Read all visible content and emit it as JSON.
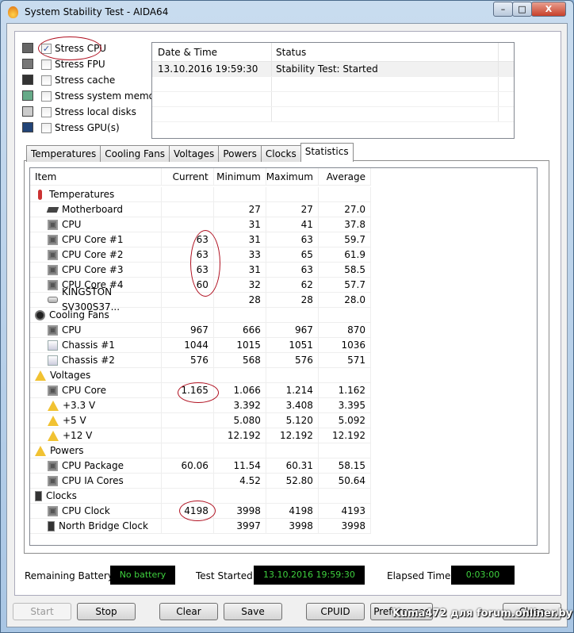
{
  "window": {
    "title": "System Stability Test - AIDA64",
    "min": "–",
    "max": "□",
    "close": "X"
  },
  "stress": [
    {
      "label": "Stress CPU",
      "checked": true,
      "icon": "cpu-icon"
    },
    {
      "label": "Stress FPU",
      "checked": false,
      "icon": "fpu-icon"
    },
    {
      "label": "Stress cache",
      "checked": false,
      "icon": "cache-icon"
    },
    {
      "label": "Stress system memory",
      "checked": false,
      "icon": "memory-icon"
    },
    {
      "label": "Stress local disks",
      "checked": false,
      "icon": "disk-icon"
    },
    {
      "label": "Stress GPU(s)",
      "checked": false,
      "icon": "gpu-icon"
    }
  ],
  "log": {
    "headers": [
      "Date & Time",
      "Status"
    ],
    "rows": [
      [
        "13.10.2016 19:59:30",
        "Stability Test: Started"
      ]
    ]
  },
  "tabs": [
    "Temperatures",
    "Cooling Fans",
    "Voltages",
    "Powers",
    "Clocks",
    "Statistics"
  ],
  "stats": {
    "headers": [
      "Item",
      "Current",
      "Minimum",
      "Maximum",
      "Average"
    ],
    "rows": [
      {
        "group": true,
        "icon": "thermo",
        "item": "Temperatures"
      },
      {
        "icon": "mb",
        "item": "Motherboard",
        "cur": "",
        "min": "27",
        "max": "27",
        "avg": "27.0"
      },
      {
        "icon": "chip",
        "item": "CPU",
        "cur": "",
        "min": "31",
        "max": "41",
        "avg": "37.8"
      },
      {
        "icon": "chip",
        "item": "CPU Core #1",
        "cur": "63",
        "min": "31",
        "max": "63",
        "avg": "59.7"
      },
      {
        "icon": "chip",
        "item": "CPU Core #2",
        "cur": "63",
        "min": "33",
        "max": "65",
        "avg": "61.9"
      },
      {
        "icon": "chip",
        "item": "CPU Core #3",
        "cur": "63",
        "min": "31",
        "max": "63",
        "avg": "58.5"
      },
      {
        "icon": "chip",
        "item": "CPU Core #4",
        "cur": "60",
        "min": "32",
        "max": "62",
        "avg": "57.7"
      },
      {
        "icon": "disk",
        "item": "KINGSTON SV300S37...",
        "cur": "",
        "min": "28",
        "max": "28",
        "avg": "28.0"
      },
      {
        "group": true,
        "icon": "fan",
        "item": "Cooling Fans"
      },
      {
        "icon": "chip",
        "item": "CPU",
        "cur": "967",
        "min": "666",
        "max": "967",
        "avg": "870"
      },
      {
        "icon": "chas",
        "item": "Chassis #1",
        "cur": "1044",
        "min": "1015",
        "max": "1051",
        "avg": "1036"
      },
      {
        "icon": "chas",
        "item": "Chassis #2",
        "cur": "576",
        "min": "568",
        "max": "576",
        "avg": "571"
      },
      {
        "group": true,
        "icon": "warn",
        "item": "Voltages"
      },
      {
        "icon": "chip",
        "item": "CPU Core",
        "cur": "1.165",
        "min": "1.066",
        "max": "1.214",
        "avg": "1.162"
      },
      {
        "icon": "warn",
        "item": "+3.3 V",
        "cur": "",
        "min": "3.392",
        "max": "3.408",
        "avg": "3.395"
      },
      {
        "icon": "warn",
        "item": "+5 V",
        "cur": "",
        "min": "5.080",
        "max": "5.120",
        "avg": "5.092"
      },
      {
        "icon": "warn",
        "item": "+12 V",
        "cur": "",
        "min": "12.192",
        "max": "12.192",
        "avg": "12.192"
      },
      {
        "group": true,
        "icon": "warn",
        "item": "Powers"
      },
      {
        "icon": "chip",
        "item": "CPU Package",
        "cur": "60.06",
        "min": "11.54",
        "max": "60.31",
        "avg": "58.15"
      },
      {
        "icon": "chip",
        "item": "CPU IA Cores",
        "cur": "",
        "min": "4.52",
        "max": "52.80",
        "avg": "50.64"
      },
      {
        "group": true,
        "icon": "clk",
        "item": "Clocks"
      },
      {
        "icon": "chip",
        "item": "CPU Clock",
        "cur": "4198",
        "min": "3998",
        "max": "4198",
        "avg": "4193"
      },
      {
        "icon": "clk",
        "item": "North Bridge Clock",
        "cur": "",
        "min": "3997",
        "max": "3998",
        "avg": "3998"
      }
    ]
  },
  "status": {
    "battery_label": "Remaining Battery:",
    "battery": "No battery",
    "started_label": "Test Started:",
    "started": "13.10.2016 19:59:30",
    "elapsed_label": "Elapsed Time:",
    "elapsed": "0:03:00"
  },
  "buttons": {
    "start": "Start",
    "stop": "Stop",
    "clear": "Clear",
    "save": "Save",
    "cpuid": "CPUID",
    "preferences": "Preferences",
    "close": "Close"
  },
  "watermark": "Kuma472 для forum.onliner.by",
  "colors": {
    "lcd_text": "#3ed03e",
    "annotation": "#b01020"
  }
}
